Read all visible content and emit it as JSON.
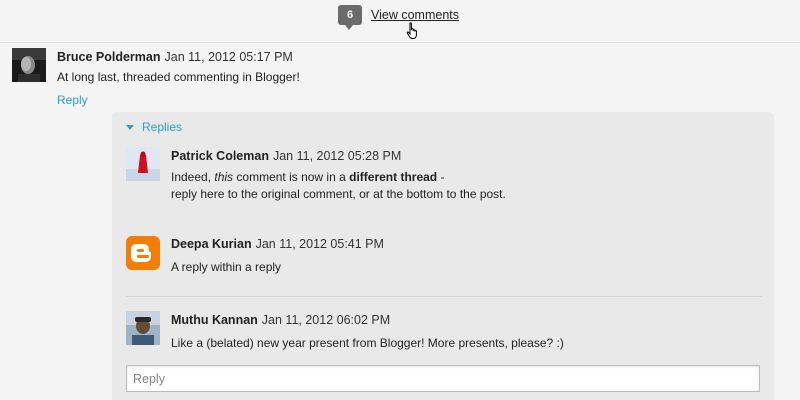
{
  "header": {
    "comment_count": "6",
    "view_comments_label": "View comments"
  },
  "comments": [
    {
      "author": "Bruce Polderman",
      "date": "Jan 11, 2012 05:17 PM",
      "text": "At long last, threaded commenting in Blogger!",
      "reply_label": "Reply"
    }
  ],
  "thread": {
    "toggle_label": "Replies",
    "replies": [
      {
        "author": "Patrick Coleman",
        "date": "Jan 11, 2012 05:28 PM",
        "text_part1": "Indeed, ",
        "text_italic": "this",
        "text_part2": " comment is now in a ",
        "text_bold": "different thread",
        "text_part3": " -",
        "text_line2": "reply here to the original comment, or at the bottom to the post."
      },
      {
        "author": "Deepa Kurian",
        "date": "Jan 11, 2012 05:41 PM",
        "text": "A reply within a reply"
      },
      {
        "author": "Muthu Kannan",
        "date": "Jan 11, 2012 06:02 PM",
        "text": "Like a (belated) new year present from Blogger! More presents, please? :)"
      }
    ],
    "reply_placeholder": "Reply"
  },
  "colors": {
    "link": "#2a9fd6",
    "blogger_orange": "#f57d00",
    "badge": "#6b6b6b"
  }
}
